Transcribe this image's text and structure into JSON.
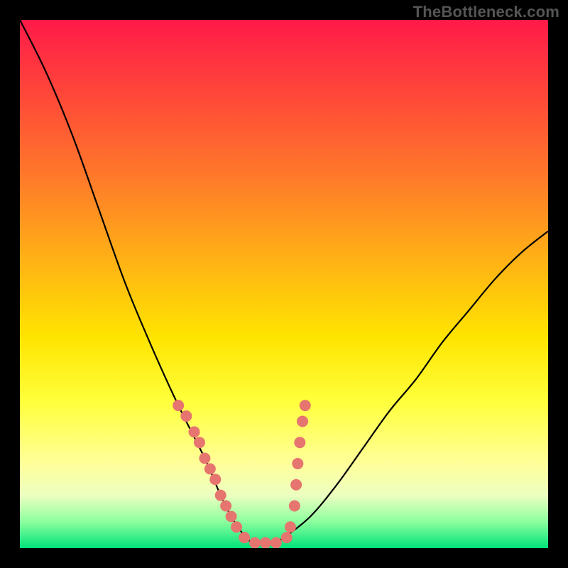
{
  "watermark": "TheBottleneck.com",
  "chart_data": {
    "type": "line",
    "title": "",
    "xlabel": "",
    "ylabel": "",
    "xlim": [
      0,
      100
    ],
    "ylim": [
      0,
      100
    ],
    "series": [
      {
        "name": "bottleneck-curve",
        "x": [
          0,
          5,
          10,
          15,
          20,
          25,
          30,
          35,
          38,
          40,
          42,
          44,
          46,
          48,
          50,
          55,
          60,
          65,
          70,
          75,
          80,
          85,
          90,
          95,
          100
        ],
        "y": [
          100,
          90,
          78,
          64,
          50,
          38,
          27,
          17,
          10,
          6,
          3,
          1,
          1,
          1,
          2,
          6,
          12,
          19,
          26,
          32,
          39,
          45,
          51,
          56,
          60
        ]
      }
    ],
    "points": {
      "name": "sample-points",
      "color": "#e6756f",
      "x": [
        30,
        31.5,
        33,
        34,
        35,
        36,
        37,
        38,
        39,
        40,
        41,
        42.5,
        44.5,
        46.5,
        48.5,
        50.5,
        51.2,
        52,
        52.3,
        52.6,
        53,
        53.5,
        54
      ],
      "y": [
        27,
        25,
        22,
        20,
        17,
        15,
        13,
        10,
        8,
        6,
        4,
        2,
        1,
        1,
        1,
        2,
        4,
        8,
        12,
        16,
        20,
        24,
        27
      ]
    }
  }
}
